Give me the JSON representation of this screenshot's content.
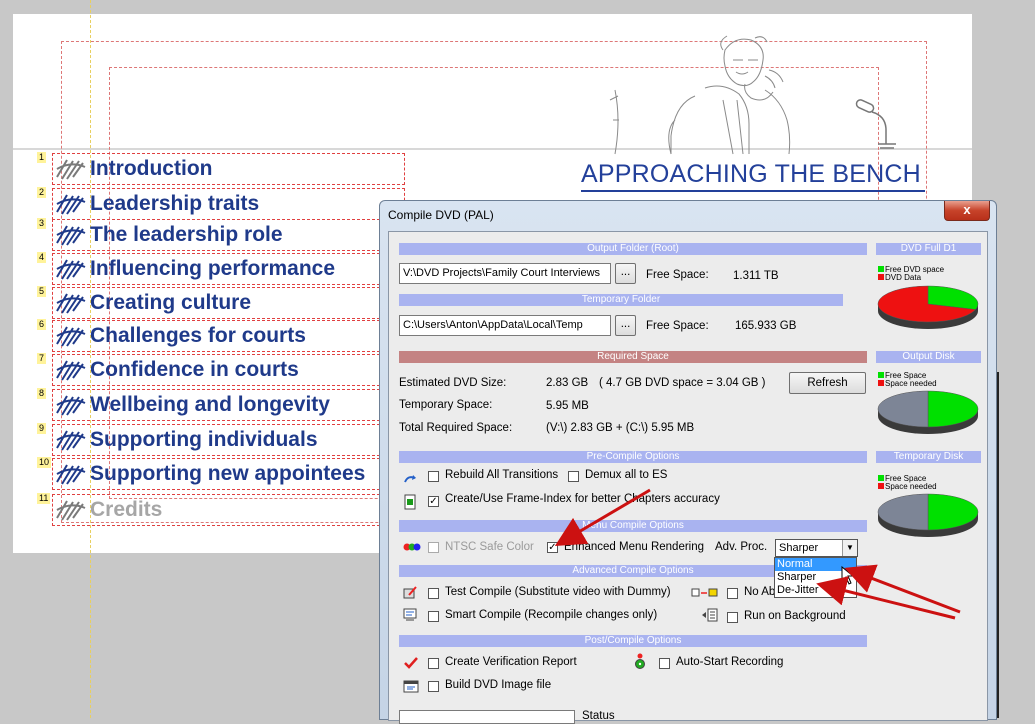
{
  "menu": {
    "title": "APPROACHING THE BENCH",
    "items": [
      {
        "num": "1",
        "label": "Introduction",
        "dim": true
      },
      {
        "num": "2",
        "label": "Leadership traits",
        "dim": false
      },
      {
        "num": "3",
        "label": "The leadership role",
        "dim": false
      },
      {
        "num": "4",
        "label": "Influencing performance",
        "dim": false
      },
      {
        "num": "5",
        "label": "Creating culture",
        "dim": false
      },
      {
        "num": "6",
        "label": "Challenges for courts",
        "dim": false
      },
      {
        "num": "7",
        "label": "Confidence in courts",
        "dim": false
      },
      {
        "num": "8",
        "label": "Wellbeing and longevity",
        "dim": false
      },
      {
        "num": "9",
        "label": "Supporting individuals",
        "dim": false
      },
      {
        "num": "10",
        "label": "Supporting new appointees",
        "dim": false
      },
      {
        "num": "11",
        "label": "Credits",
        "dim": true
      }
    ]
  },
  "dialog": {
    "title": "Compile DVD (PAL)",
    "close_label": "x",
    "output_folder": {
      "header": "Output Folder (Root)",
      "path": "V:\\DVD Projects\\Family Court Interviews",
      "browse_label": "...",
      "free_space_label": "Free Space:",
      "free_space_value": "1.311 TB"
    },
    "temp_folder": {
      "header": "Temporary Folder",
      "path": "C:\\Users\\Anton\\AppData\\Local\\Temp",
      "browse_label": "...",
      "free_space_label": "Free Space:",
      "free_space_value": "165.933 GB"
    },
    "required_space": {
      "header": "Required Space",
      "estimated_label": "Estimated DVD Size:",
      "estimated_value": "2.83 GB",
      "estimated_note": "( 4.7 GB DVD space = 3.04 GB )",
      "temporary_label": "Temporary Space:",
      "temporary_value": "5.95 MB",
      "total_label": "Total Required Space:",
      "total_value": "(V:\\) 2.83 GB + (C:\\) 5.95 MB",
      "refresh_label": "Refresh"
    },
    "precompile": {
      "header": "Pre-Compile Options",
      "rebuild_label": "Rebuild All Transitions",
      "rebuild_checked": false,
      "demux_label": "Demux all to ES",
      "demux_checked": false,
      "frameindex_label": "Create/Use Frame-Index for better Chapters accuracy",
      "frameindex_checked": true
    },
    "menu_compile": {
      "header": "Menu Compile Options",
      "ntsc_label": "NTSC Safe Color",
      "ntsc_checked": false,
      "enhanced_label": "Enhanced Menu Rendering",
      "enhanced_checked": true,
      "advproc_label": "Adv. Proc.",
      "advproc_value": "Sharper",
      "dropdown_options": [
        "Normal",
        "Sharper",
        "De-Jitter"
      ],
      "dropdown_highlighted": "Normal"
    },
    "advanced": {
      "header": "Advanced Compile Options",
      "test_label": "Test Compile (Substitute video with Dummy)",
      "test_checked": false,
      "noab_label": "No Ab",
      "noab_checked": false,
      "smart_label": "Smart Compile (Recompile changes only)",
      "smart_checked": false,
      "background_label": "Run on Background",
      "background_checked": false
    },
    "post": {
      "header": "Post/Compile Options",
      "verification_label": "Create Verification Report",
      "verification_checked": false,
      "autostart_label": "Auto-Start Recording",
      "autostart_checked": false,
      "image_label": "Build DVD Image file",
      "image_checked": false
    },
    "status_label": "Status",
    "disks": [
      {
        "header": "DVD Full D1",
        "legend_a": "Free DVD space",
        "legend_b": "DVD Data",
        "fraction_a": 0.3,
        "color_a": "#00e000",
        "color_b": "#ee1111"
      },
      {
        "header": "Output Disk",
        "legend_a": "Free Space",
        "legend_b": "Space needed",
        "fraction_a": 0.5,
        "color_a": "#00e000",
        "color_b": "#7d8596"
      },
      {
        "header": "Temporary Disk",
        "legend_a": "Free Space",
        "legend_b": "Space needed",
        "fraction_a": 0.5,
        "color_a": "#00e000",
        "color_b": "#7d8596"
      }
    ]
  },
  "colors": {
    "accent": "#23409a",
    "bar": "#a9b3f0",
    "bar_red": "#c48383",
    "arrow": "#cc1111"
  }
}
